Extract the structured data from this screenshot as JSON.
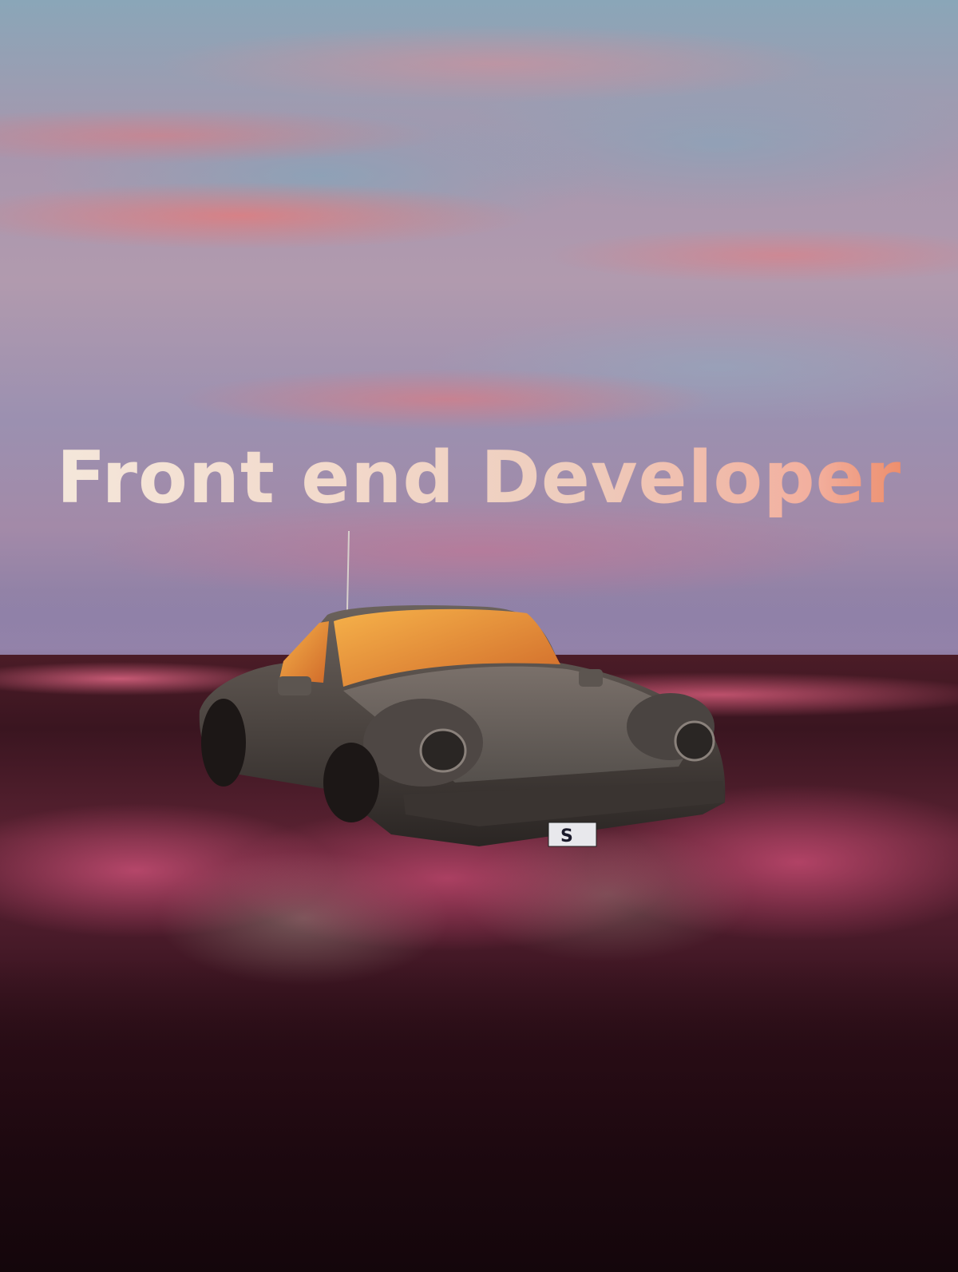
{
  "headline": "Front end Developer",
  "license_plate": "S",
  "colors": {
    "sky_top": "#8aa6b8",
    "cloud_pink": "#e87878",
    "field_pink": "#cd5078",
    "field_dark": "#2e1019",
    "car_body": "#4a4442",
    "window_glow": "#f0a040",
    "headline_start": "#f3e6d8",
    "headline_end": "#e8622e"
  },
  "scene": {
    "subject": "vintage sports car",
    "setting": "pink flower field at sunset"
  }
}
